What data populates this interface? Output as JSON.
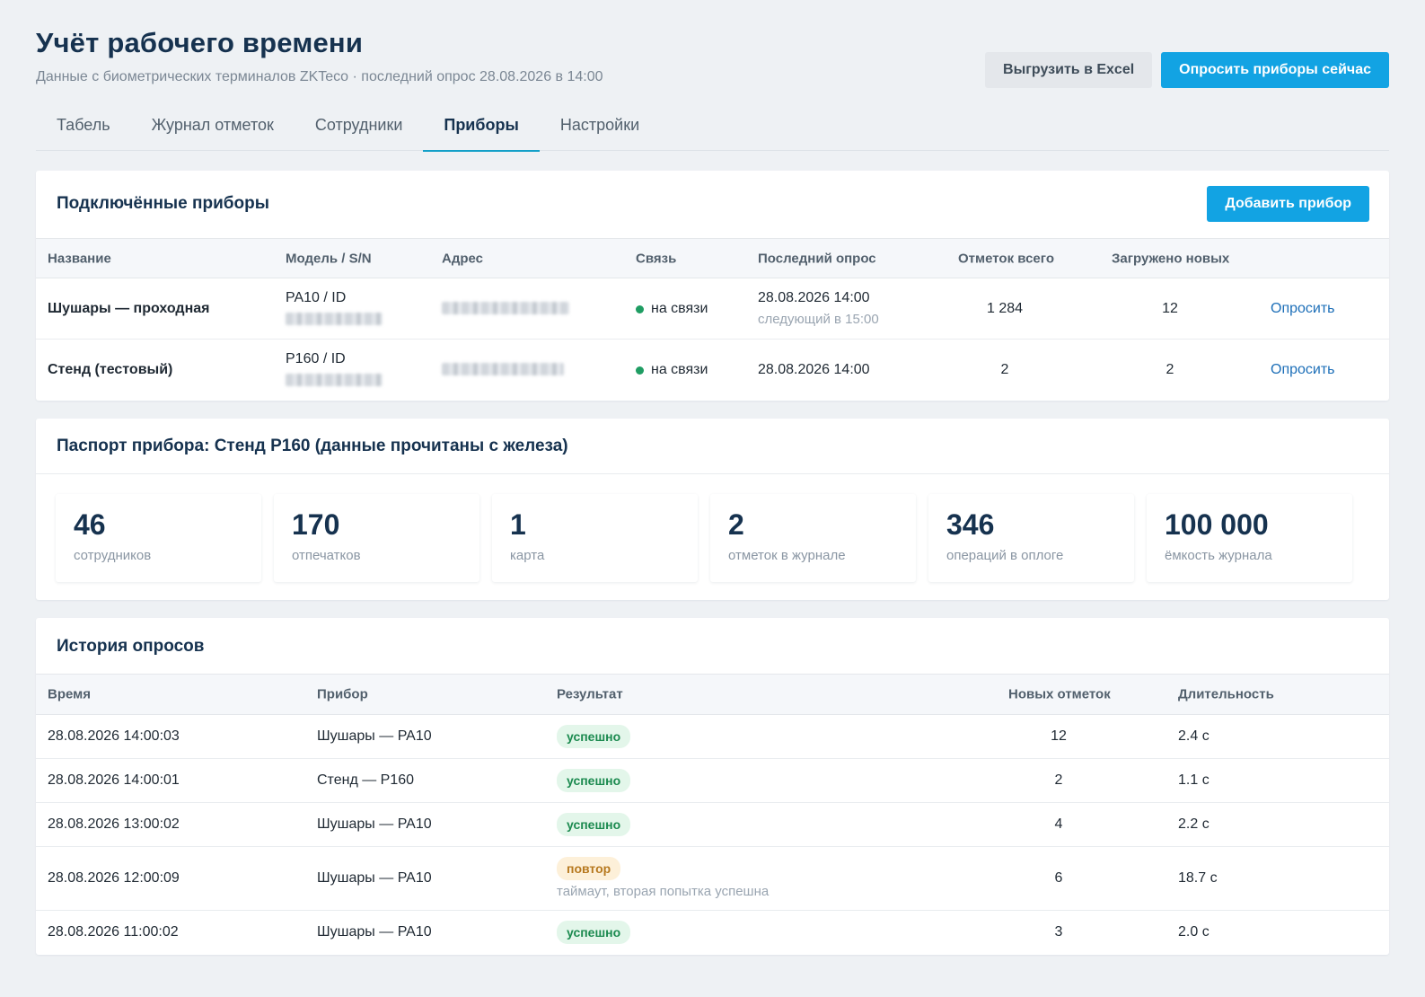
{
  "header": {
    "title": "Учёт рабочего времени",
    "subtitle": "Данные с биометрических терминалов ZKTeco · последний опрос 28.08.2026 в 14:00",
    "export_label": "Выгрузить в Excel",
    "poll_all_label": "Опросить приборы сейчас"
  },
  "tabs": [
    {
      "label": "Табель",
      "active": false
    },
    {
      "label": "Журнал отметок",
      "active": false
    },
    {
      "label": "Сотрудники",
      "active": false
    },
    {
      "label": "Приборы",
      "active": true
    },
    {
      "label": "Настройки",
      "active": false
    }
  ],
  "devices": {
    "title": "Подключённые приборы",
    "add_label": "Добавить прибор",
    "columns": [
      "Название",
      "Модель / S/N",
      "Адрес",
      "Связь",
      "Последний опрос",
      "Отметок всего",
      "Загружено новых"
    ],
    "rows": [
      {
        "name": "Шушары — проходная",
        "model": "PA10 / ID",
        "status": "на связи",
        "last_poll": "28.08.2026 14:00",
        "next_poll": "следующий в 15:00",
        "total": "1 284",
        "new": "12",
        "action": "Опросить"
      },
      {
        "name": "Стенд (тестовый)",
        "model": "P160 / ID",
        "status": "на связи",
        "last_poll": "28.08.2026 14:00",
        "next_poll": "",
        "total": "2",
        "new": "2",
        "action": "Опросить"
      }
    ]
  },
  "passport": {
    "title": "Паспорт прибора: Стенд P160 (данные прочитаны с железа)",
    "stats": [
      {
        "value": "46",
        "label": "сотрудников"
      },
      {
        "value": "170",
        "label": "отпечатков"
      },
      {
        "value": "1",
        "label": "карта"
      },
      {
        "value": "2",
        "label": "отметок в журнале"
      },
      {
        "value": "346",
        "label": "операций в оплоге"
      },
      {
        "value": "100 000",
        "label": "ёмкость журнала"
      }
    ]
  },
  "history": {
    "title": "История опросов",
    "columns": [
      "Время",
      "Прибор",
      "Результат",
      "Новых отметок",
      "Длительность"
    ],
    "rows": [
      {
        "time": "28.08.2026 14:00:03",
        "device": "Шушары — PA10",
        "result": "успешно",
        "result_type": "success",
        "note": "",
        "new": "12",
        "duration": "2.4 с"
      },
      {
        "time": "28.08.2026 14:00:01",
        "device": "Стенд — P160",
        "result": "успешно",
        "result_type": "success",
        "note": "",
        "new": "2",
        "duration": "1.1 с"
      },
      {
        "time": "28.08.2026 13:00:02",
        "device": "Шушары — PA10",
        "result": "успешно",
        "result_type": "success",
        "note": "",
        "new": "4",
        "duration": "2.2 с"
      },
      {
        "time": "28.08.2026 12:00:09",
        "device": "Шушары — PA10",
        "result": "повтор",
        "result_type": "retry",
        "note": "таймаут, вторая попытка успешна",
        "new": "6",
        "duration": "18.7 с"
      },
      {
        "time": "28.08.2026 11:00:02",
        "device": "Шушары — PA10",
        "result": "успешно",
        "result_type": "success",
        "note": "",
        "new": "3",
        "duration": "2.0 с"
      }
    ]
  },
  "colors": {
    "accent": "#12a3e3",
    "title": "#16324f",
    "online": "#1f9d63",
    "success_bg": "#e3f6ea",
    "retry_bg": "#fdf0d9"
  }
}
